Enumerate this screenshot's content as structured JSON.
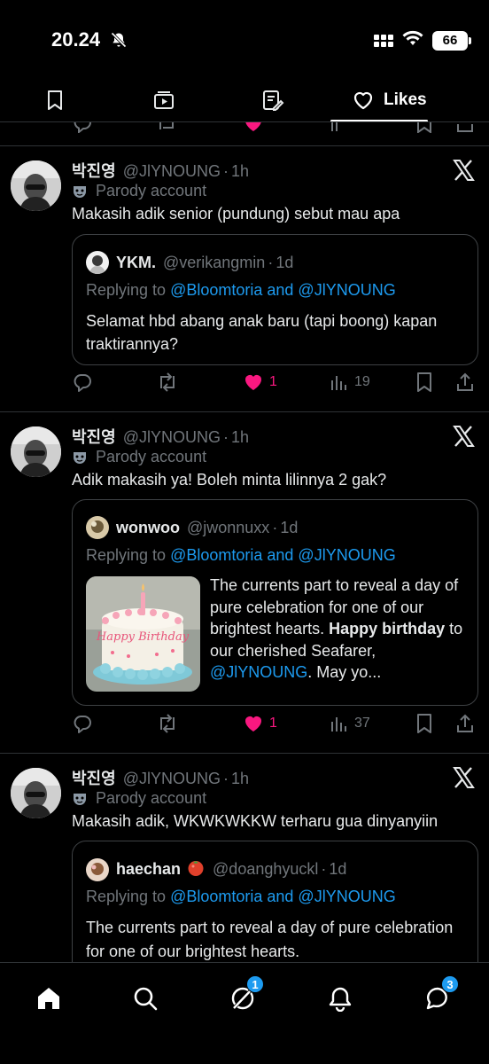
{
  "status_bar": {
    "time": "20.24",
    "battery": "66"
  },
  "tabs": {
    "likes_label": "Likes"
  },
  "tweets": [
    {
      "display_name": "박진영",
      "handle": "@JlYNOUNG",
      "time": "1h",
      "parody": "Parody account",
      "text": "Makasih adik senior (pundung) sebut mau apa",
      "quote": {
        "name": "YKM.",
        "handle": "@verikangmin",
        "time": "1d",
        "replying_prefix": "Replying to",
        "replying_mentions": "@Bloomtoria and @JlYNOUNG",
        "text": "Selamat hbd abang anak baru (tapi boong) kapan traktirannya?"
      },
      "likes": "1",
      "views": "19"
    },
    {
      "display_name": "박진영",
      "handle": "@JlYNOUNG",
      "time": "1h",
      "parody": "Parody account",
      "text": "Adik makasih ya! Boleh minta lilinnya 2 gak?",
      "quote": {
        "name": "wonwoo",
        "handle": "@jwonnuxx",
        "time": "1d",
        "replying_prefix": "Replying to",
        "replying_mentions": "@Bloomtoria and @JlYNOUNG",
        "text_part1": "The currents part to reveal a day of pure celebration for one of our brightest hearts.",
        "text_bold": "Happy birthday",
        "text_part2": "to our cherished Seafarer,",
        "text_mention": "@JlYNOUNG",
        "text_part3": ". May yo...",
        "image_text": "Happy Birthday"
      },
      "likes": "1",
      "views": "37"
    },
    {
      "display_name": "박진영",
      "handle": "@JlYNOUNG",
      "time": "1h",
      "parody": "Parody account",
      "text": "Makasih adik, WKWKWKKW terharu gua dinyanyiin",
      "quote": {
        "name": "haechan",
        "emoji": "🍅",
        "handle": "@doanghyuckl",
        "time": "1d",
        "replying_prefix": "Replying to",
        "replying_mentions": "@Bloomtoria and @JlYNOUNG",
        "text": "The currents part to reveal a day of pure celebration for one of our brightest hearts."
      }
    }
  ],
  "nav": {
    "grok_badge": "1",
    "messages_badge": "3"
  },
  "colors": {
    "accent": "#1d9bf0",
    "like": "#f91880",
    "muted": "#71767b",
    "text": "#e7e9ea"
  }
}
